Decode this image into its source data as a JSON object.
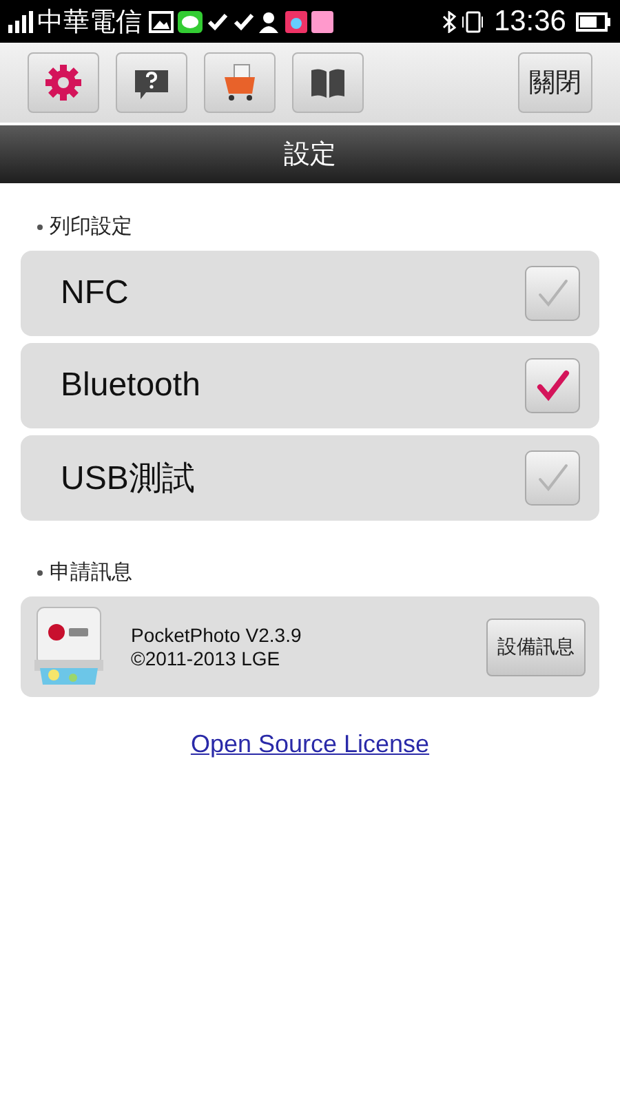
{
  "status_bar": {
    "carrier": "中華電信",
    "time": "13:36"
  },
  "toolbar": {
    "buttons": [
      {
        "kind": "settings"
      },
      {
        "kind": "help"
      },
      {
        "kind": "cart"
      },
      {
        "kind": "book"
      }
    ],
    "close": "關閉"
  },
  "title": "設定",
  "sections": [
    {
      "heading": "列印設定",
      "kind": "checklist",
      "items": [
        {
          "label": "NFC",
          "checked": false
        },
        {
          "label": "Bluetooth",
          "checked": true
        },
        {
          "label": "USB測試",
          "checked": false
        }
      ]
    },
    {
      "heading": "申請訊息",
      "kind": "app_info",
      "app": {
        "name": "PocketPhoto V2.3.9",
        "copyright": "©2011-2013 LGE",
        "button": "設備訊息"
      }
    }
  ],
  "link": "Open Source License"
}
